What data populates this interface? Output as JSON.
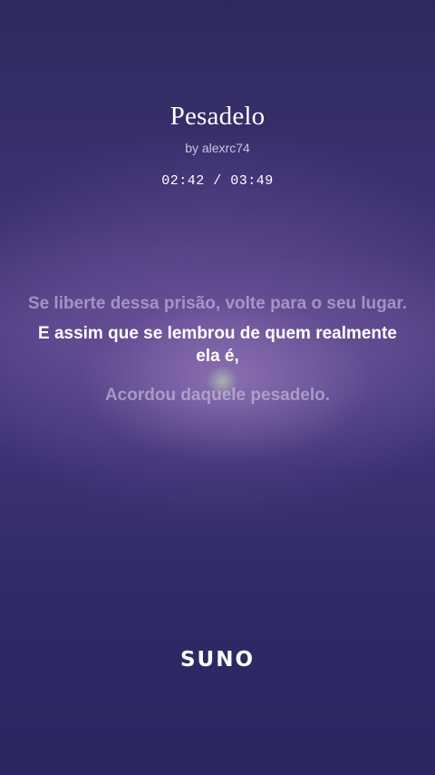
{
  "song": {
    "title": "Pesadelo",
    "artist": "by alexrc74",
    "time": "02:42 / 03:49"
  },
  "lyrics": {
    "previous": "Se liberte dessa prisão, volte para o seu lugar.",
    "current": "E assim que se lembrou de quem realmente ela é,",
    "next": "Acordou daquele pesadelo."
  },
  "brand": {
    "logo": "SUNO"
  },
  "colors": {
    "background": "#2e2660",
    "current_lyric": "#ffffff",
    "inactive_lyric": "#cdc3e4"
  }
}
